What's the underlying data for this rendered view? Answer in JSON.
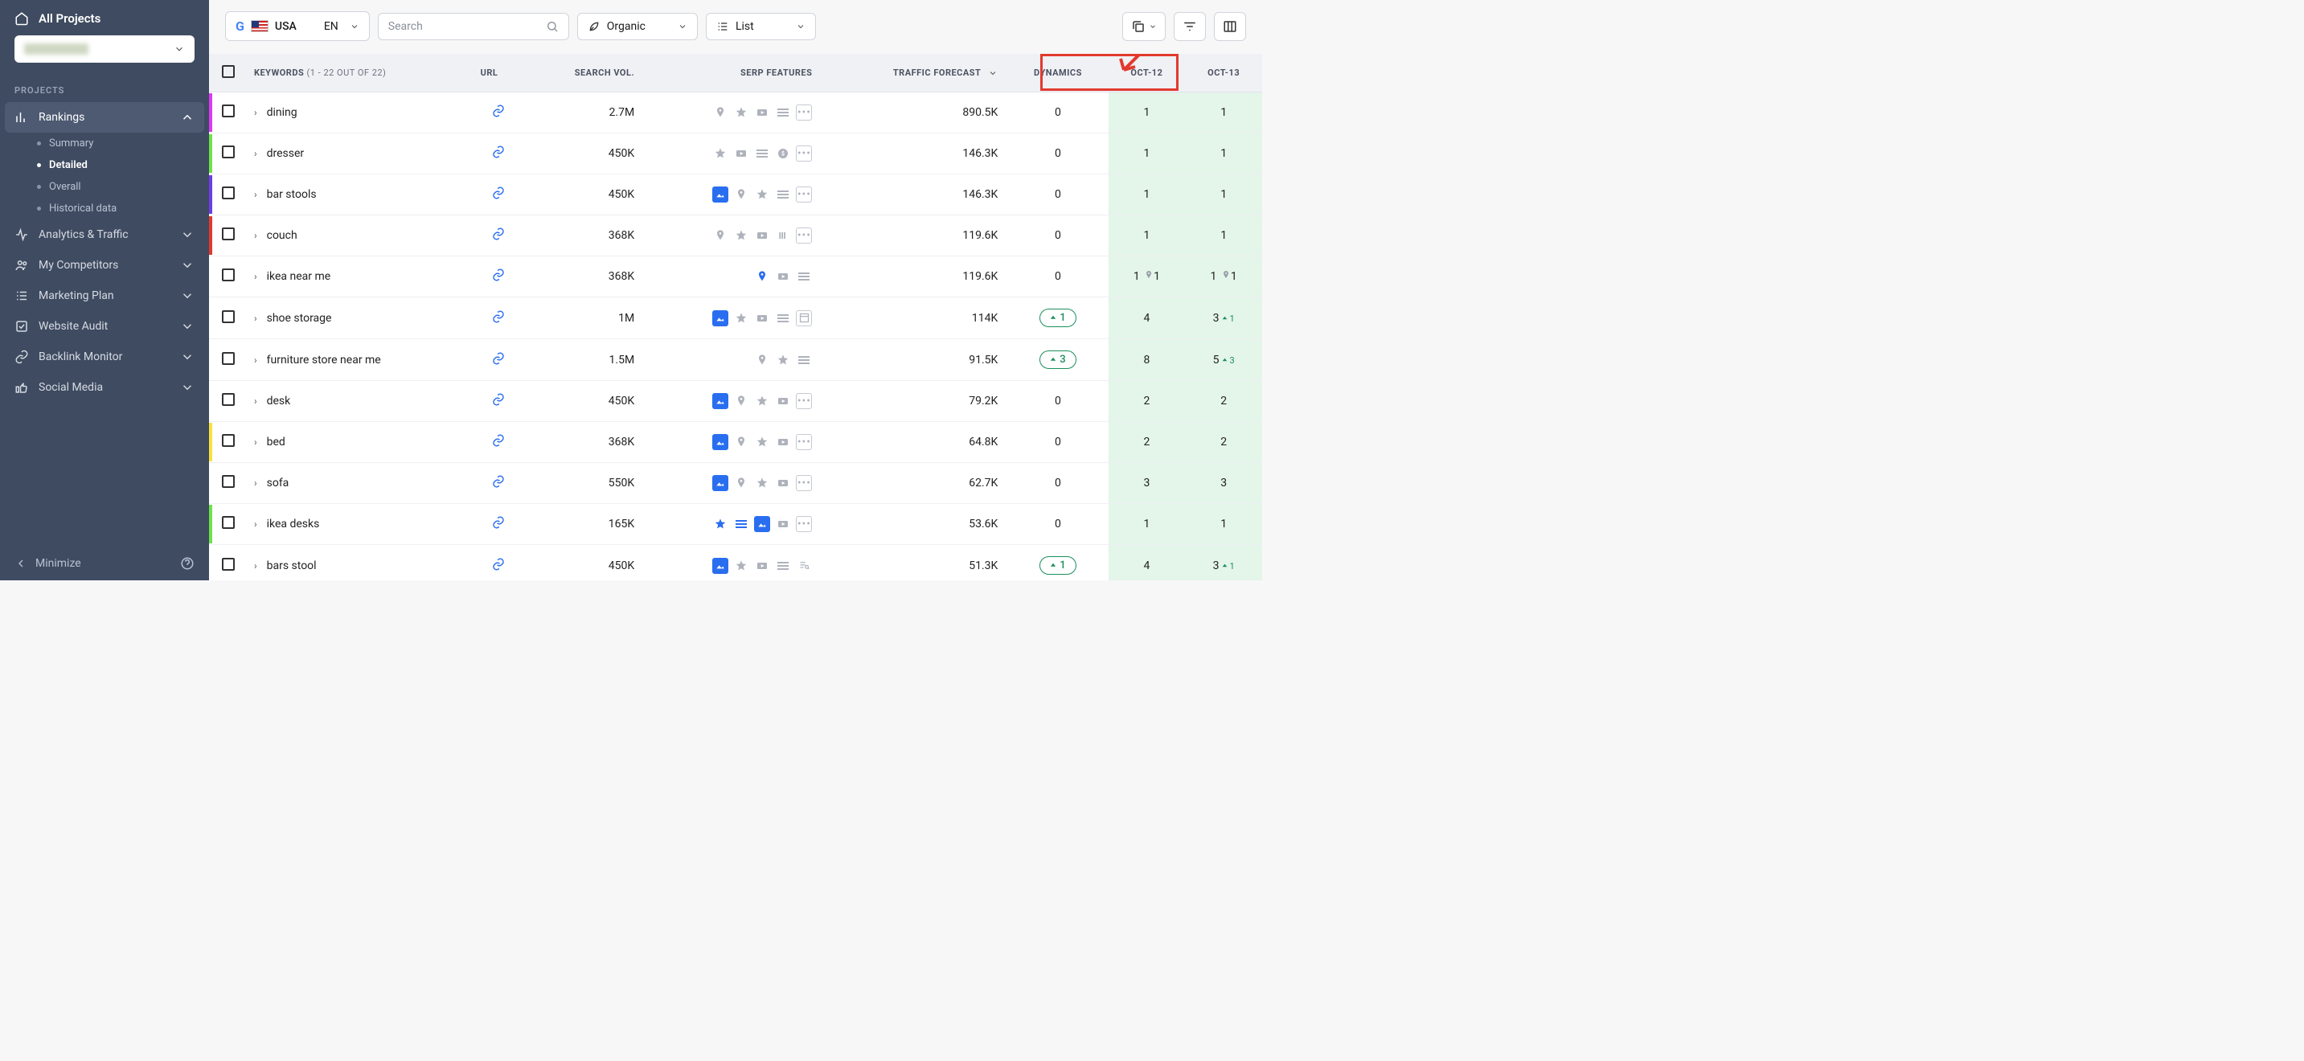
{
  "sidebar": {
    "all_projects": "All Projects",
    "section_label": "PROJECTS",
    "items": [
      {
        "label": "Rankings",
        "icon": "bar-icon",
        "expanded": true,
        "active": true
      },
      {
        "label": "Analytics & Traffic",
        "icon": "pulse-icon"
      },
      {
        "label": "My Competitors",
        "icon": "people-icon"
      },
      {
        "label": "Marketing Plan",
        "icon": "list-icon"
      },
      {
        "label": "Website Audit",
        "icon": "audit-icon"
      },
      {
        "label": "Backlink Monitor",
        "icon": "link-icon"
      },
      {
        "label": "Social Media",
        "icon": "thumb-icon"
      }
    ],
    "subnav": [
      {
        "label": "Summary"
      },
      {
        "label": "Detailed",
        "active": true
      },
      {
        "label": "Overall"
      },
      {
        "label": "Historical data"
      }
    ],
    "minimize": "Minimize"
  },
  "toolbar": {
    "country": "USA",
    "lang": "EN",
    "search_placeholder": "Search",
    "organic": "Organic",
    "list": "List"
  },
  "table": {
    "header": {
      "keywords": "KEYWORDS",
      "keywords_count": "(1 - 22 OUT OF 22)",
      "url": "URL",
      "search_vol": "SEARCH VOL.",
      "serp": "SERP FEATURES",
      "traffic": "TRAFFIC FORECAST",
      "dynamics": "DYNAMICS",
      "d1": "OCT-12",
      "d2": "OCT-13"
    },
    "rows": [
      {
        "c": "#d93af0",
        "kw": "dining",
        "vol": "2.7M",
        "serp": [
          "pin",
          "star",
          "video",
          "faq",
          "more"
        ],
        "tf": "890.5K",
        "dyn": "0",
        "dyn_pill": false,
        "d1": "1",
        "d2": "1"
      },
      {
        "c": "#6de24a",
        "kw": "dresser",
        "vol": "450K",
        "serp": [
          "star",
          "video",
          "faq",
          "dollar",
          "more"
        ],
        "tf": "146.3K",
        "dyn": "0",
        "dyn_pill": false,
        "d1": "1",
        "d2": "1"
      },
      {
        "c": "#6c3de8",
        "kw": "bar stools",
        "vol": "450K",
        "serp": [
          "img",
          "pin",
          "star",
          "faq",
          "more"
        ],
        "tf": "146.3K",
        "dyn": "0",
        "dyn_pill": false,
        "d1": "1",
        "d2": "1"
      },
      {
        "c": "#e2382f",
        "kw": "couch",
        "vol": "368K",
        "serp": [
          "pin",
          "star",
          "video",
          "cols",
          "more"
        ],
        "tf": "119.6K",
        "dyn": "0",
        "dyn_pill": false,
        "d1": "1",
        "d2": "1"
      },
      {
        "c": "#ffffff",
        "kw": "ikea near me",
        "vol": "368K",
        "serp": [
          "pin-blue",
          "video",
          "faq"
        ],
        "tf": "119.6K",
        "dyn": "0",
        "dyn_pill": false,
        "d1": "1",
        "d1_pin": "1",
        "d2": "1",
        "d2_pin": "1"
      },
      {
        "c": "#ffffff",
        "kw": "shoe storage",
        "vol": "1M",
        "serp": [
          "img",
          "star",
          "video",
          "faq",
          "sq"
        ],
        "tf": "114K",
        "dyn": "1",
        "dyn_pill": true,
        "d1": "4",
        "d2": "3",
        "d2_up": "1"
      },
      {
        "c": "#ffffff",
        "kw": "furniture store near me",
        "vol": "1.5M",
        "serp": [
          "pin",
          "star",
          "faq"
        ],
        "tf": "91.5K",
        "dyn": "3",
        "dyn_pill": true,
        "d1": "8",
        "d2": "5",
        "d2_up": "3"
      },
      {
        "c": "#ffffff",
        "kw": "desk",
        "vol": "450K",
        "serp": [
          "img",
          "pin",
          "star",
          "video",
          "more"
        ],
        "tf": "79.2K",
        "dyn": "0",
        "dyn_pill": false,
        "d1": "2",
        "d2": "2"
      },
      {
        "c": "#f7e23c",
        "kw": "bed",
        "vol": "368K",
        "serp": [
          "img",
          "pin",
          "star",
          "video",
          "more"
        ],
        "tf": "64.8K",
        "dyn": "0",
        "dyn_pill": false,
        "d1": "2",
        "d2": "2"
      },
      {
        "c": "#ffffff",
        "kw": "sofa",
        "vol": "550K",
        "serp": [
          "img",
          "pin",
          "star",
          "video",
          "more"
        ],
        "tf": "62.7K",
        "dyn": "0",
        "dyn_pill": false,
        "d1": "3",
        "d2": "3"
      },
      {
        "c": "#6de24a",
        "kw": "ikea desks",
        "vol": "165K",
        "serp": [
          "star-blue",
          "faq-blue",
          "img",
          "video",
          "more"
        ],
        "tf": "53.6K",
        "dyn": "0",
        "dyn_pill": false,
        "d1": "1",
        "d2": "1"
      },
      {
        "c": "#ffffff",
        "kw": "bars stool",
        "vol": "450K",
        "serp": [
          "img",
          "star",
          "video",
          "faq",
          "search"
        ],
        "tf": "51.3K",
        "dyn": "1",
        "dyn_pill": true,
        "d1": "4",
        "d2": "3",
        "d2_up": "1"
      }
    ]
  }
}
